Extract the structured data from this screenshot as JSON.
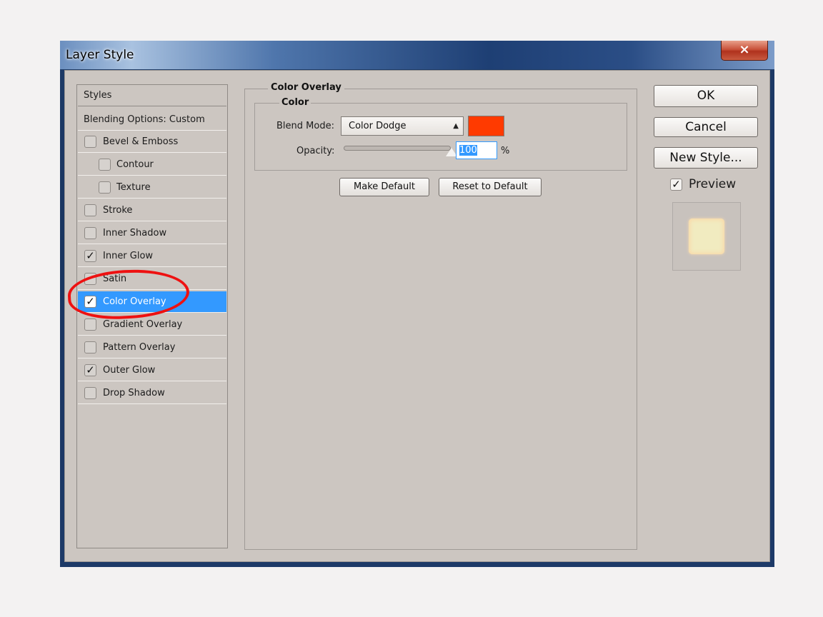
{
  "window": {
    "title": "Layer Style",
    "close_label": "×"
  },
  "styles": {
    "header": "Styles",
    "blending": "Blending Options: Custom",
    "items": [
      {
        "label": "Bevel & Emboss",
        "checked": false
      },
      {
        "label": "Contour",
        "checked": false
      },
      {
        "label": "Texture",
        "checked": false
      },
      {
        "label": "Stroke",
        "checked": false
      },
      {
        "label": "Inner Shadow",
        "checked": false
      },
      {
        "label": "Inner Glow",
        "checked": true
      },
      {
        "label": "Satin",
        "checked": false
      },
      {
        "label": "Color Overlay",
        "checked": true
      },
      {
        "label": "Gradient Overlay",
        "checked": false
      },
      {
        "label": "Pattern Overlay",
        "checked": false
      },
      {
        "label": "Outer Glow",
        "checked": true
      },
      {
        "label": "Drop Shadow",
        "checked": false
      }
    ]
  },
  "panel": {
    "title": "Color Overlay",
    "group_title": "Color",
    "blend_mode_label": "Blend Mode:",
    "blend_mode_value": "Color Dodge",
    "overlay_color": "#ff3a00",
    "opacity_label": "Opacity:",
    "opacity_value": "100",
    "opacity_unit": "%",
    "opacity_level": 1.0,
    "make_default": "Make Default",
    "reset_default": "Reset to Default"
  },
  "actions": {
    "ok": "OK",
    "cancel": "Cancel",
    "new_style": "New Style...",
    "preview_label": "Preview",
    "preview_checked": true
  },
  "colors": {
    "selection": "#3399ff",
    "dialog_bg": "#ccc6c1",
    "annotation": "#ee1111"
  }
}
